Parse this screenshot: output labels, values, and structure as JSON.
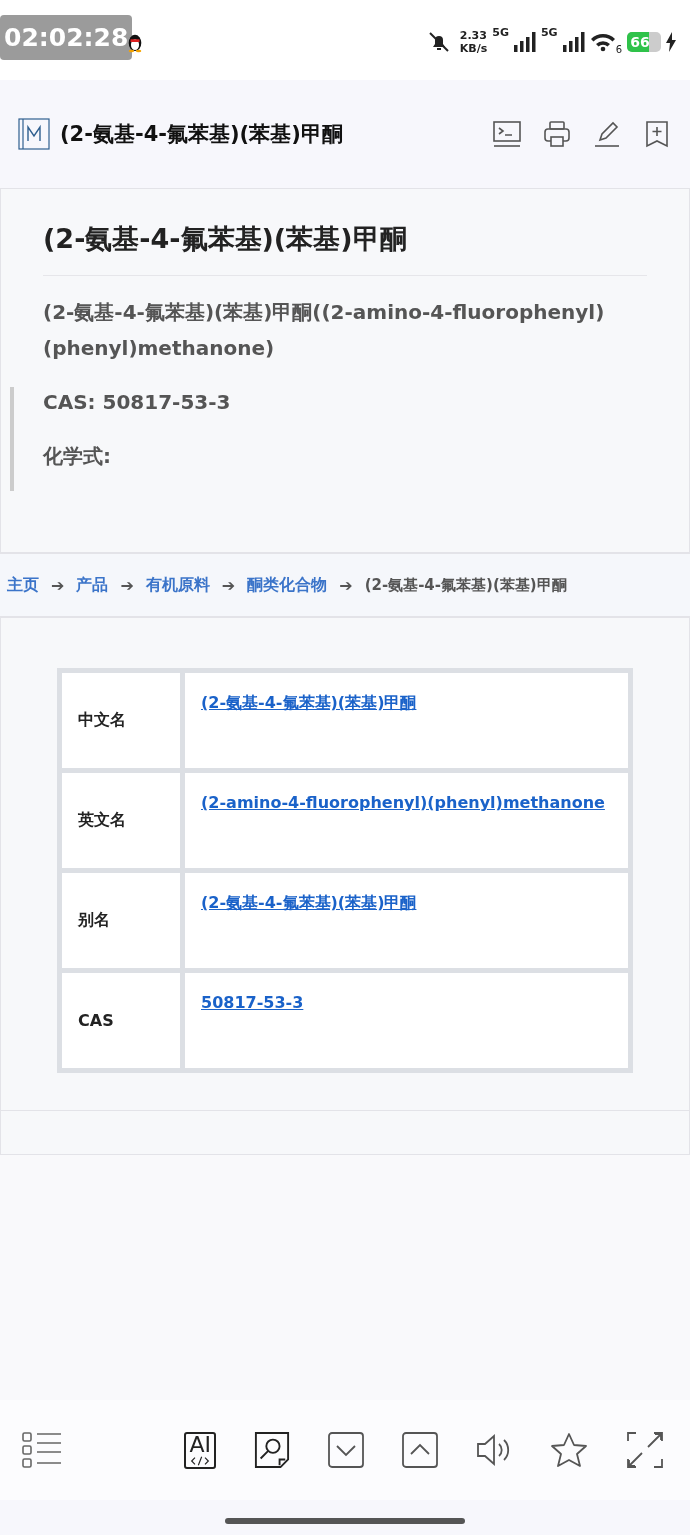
{
  "status_bar": {
    "recording_timer": "02:02:28",
    "net_speed": "2.33",
    "net_unit": "KB/s",
    "sim_labels": [
      "5G",
      "5G"
    ],
    "wifi_badge": "6",
    "battery": "66",
    "level": 0.66,
    "charging": true
  },
  "header": {
    "title": "(2-氨基-4-氟苯基)(苯基)甲酮"
  },
  "article": {
    "heading": "(2-氨基-4-氟苯基)(苯基)甲酮",
    "name_line": "(2-氨基-4-氟苯基)(苯基)甲酮((2-amino-4-fluorophenyl)(phenyl)methanone)",
    "cas_line": "CAS: 50817-53-3",
    "formula_label": "化学式:"
  },
  "breadcrumb": {
    "separator": "➔",
    "links": [
      "主页",
      "产品",
      "有机原料",
      "酮类化合物"
    ],
    "current": "(2-氨基-4-氟苯基)(苯基)甲酮"
  },
  "table": {
    "rows": [
      {
        "label": "中文名",
        "value": "(2-氨基-4-氟苯基)(苯基)甲酮"
      },
      {
        "label": "英文名",
        "value": "(2-amino-4-fluorophenyl)(phenyl)methanone"
      },
      {
        "label": "别名",
        "value": "(2-氨基-4-氟苯基)(苯基)甲酮"
      },
      {
        "label": "CAS",
        "value": "50817-53-3"
      }
    ]
  },
  "toolbar": {
    "ai_label": "AI"
  }
}
